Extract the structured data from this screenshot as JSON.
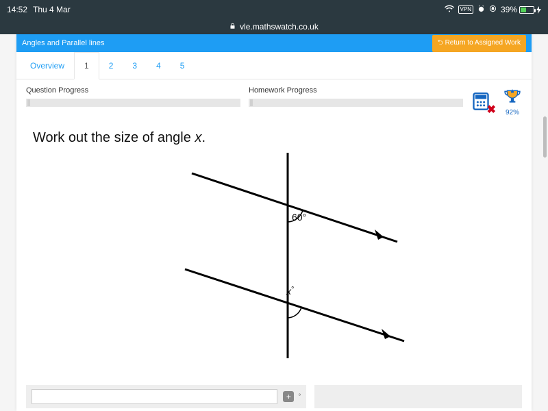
{
  "status": {
    "time": "14:52",
    "date": "Thu 4 Mar",
    "vpn": "VPN",
    "battery_pct": "39%"
  },
  "browser": {
    "url": "vle.mathswatch.co.uk"
  },
  "header": {
    "breadcrumb": "Angles and Parallel lines",
    "return_label": "Return to Assigned Work"
  },
  "tabs": {
    "items": [
      "Overview",
      "1",
      "2",
      "3",
      "4",
      "5"
    ],
    "selected_index": 1
  },
  "progress": {
    "question_label": "Question Progress",
    "homework_label": "Homework Progress",
    "trophy_pct": "92%"
  },
  "question": {
    "prefix": "Work out the size of angle ",
    "var": "x",
    "suffix": "."
  },
  "diagram": {
    "known_angle": "60°",
    "unknown_angle": "x°"
  },
  "answer": {
    "unit": "°"
  }
}
